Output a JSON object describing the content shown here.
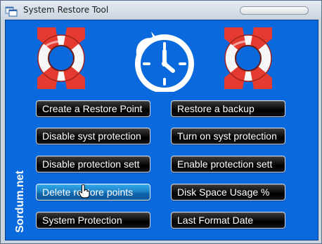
{
  "window": {
    "title": "System Restore Tool"
  },
  "brand": {
    "watermark": "Sordum.net"
  },
  "icons": {
    "app": "app-window-icon",
    "left": "lifebuoy-icon",
    "center": "restore-clock-icon",
    "right": "lifebuoy-icon"
  },
  "buttons": {
    "create_restore_point": "Create a Restore Point",
    "restore_backup": "Restore a backup",
    "disable_syst_protection": "Disable syst protection",
    "turn_on_syst_protection": "Turn on syst protection",
    "disable_protection_sett": "Disable protection sett",
    "enable_protection_sett": "Enable protection sett",
    "delete_restore_points": "Delete restore points",
    "disk_space_usage": "Disk Space Usage %",
    "system_protection": "System Protection",
    "last_format_date": "Last Format Date"
  },
  "colors": {
    "client_bg": "#0a69dc",
    "button_bg": "#000000",
    "button_hover": "#1f84c9",
    "lifebuoy_red": "#e43a2f"
  }
}
